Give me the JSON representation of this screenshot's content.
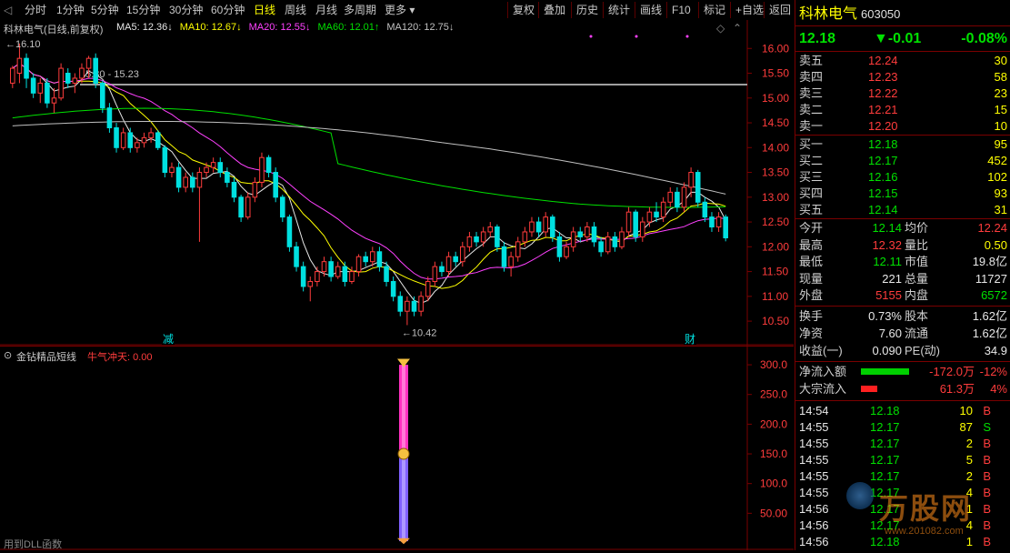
{
  "toolbar": {
    "periods": [
      "分时",
      "1分钟",
      "5分钟",
      "15分钟",
      "30分钟",
      "60分钟",
      "日线",
      "周线",
      "月线",
      "多周期",
      "更多"
    ],
    "active_period": "日线",
    "actions": [
      "复权",
      "叠加",
      "历史",
      "统计",
      "画线",
      "F10",
      "标记",
      "+自选",
      "返回"
    ]
  },
  "main_chart": {
    "title": "科林电气(日线,前复权)",
    "ma_legend": [
      {
        "label": "MA5: 12.36↓",
        "color": "#e8e8e8"
      },
      {
        "label": "MA10: 12.67↓",
        "color": "#ffff00"
      },
      {
        "label": "MA20: 12.55↓",
        "color": "#ff40ff"
      },
      {
        "label": "MA60: 12.01↑",
        "color": "#00e000"
      },
      {
        "label": "MA120: 12.75↓",
        "color": "#c0c0c0"
      }
    ],
    "high_label": "16.10",
    "low_label": "←10.42",
    "range_label": "15.30 - 15.23",
    "event_labels": [
      "减",
      "财"
    ],
    "y_ticks": [
      "16.00",
      "15.50",
      "15.00",
      "14.50",
      "14.00",
      "13.50",
      "13.00",
      "12.50",
      "12.00",
      "11.50",
      "11.00",
      "10.50"
    ]
  },
  "indicator": {
    "name": "金钻精品短线",
    "signal": "牛气冲天: 0.00",
    "y_ticks": [
      "300.0",
      "250.0",
      "200.0",
      "150.0",
      "100.0",
      "50.00"
    ],
    "bottom_text": "用到DLL函数"
  },
  "stock": {
    "name": "科林电气",
    "code": "603050",
    "price": "12.18",
    "change": "▼-0.01",
    "change_pct": "-0.08%"
  },
  "order_book": {
    "asks": [
      {
        "label": "卖五",
        "price": "12.24",
        "vol": "30"
      },
      {
        "label": "卖四",
        "price": "12.23",
        "vol": "58"
      },
      {
        "label": "卖三",
        "price": "12.22",
        "vol": "23"
      },
      {
        "label": "卖二",
        "price": "12.21",
        "vol": "15"
      },
      {
        "label": "卖一",
        "price": "12.20",
        "vol": "10"
      }
    ],
    "bids": [
      {
        "label": "买一",
        "price": "12.18",
        "vol": "95"
      },
      {
        "label": "买二",
        "price": "12.17",
        "vol": "452"
      },
      {
        "label": "买三",
        "price": "12.16",
        "vol": "102"
      },
      {
        "label": "买四",
        "price": "12.15",
        "vol": "93"
      },
      {
        "label": "买五",
        "price": "12.14",
        "vol": "31"
      }
    ]
  },
  "stats": [
    {
      "l1": "今开",
      "v1": "12.14",
      "c1": "grn",
      "l2": "均价",
      "v2": "12.24",
      "c2": "red"
    },
    {
      "l1": "最高",
      "v1": "12.32",
      "c1": "red",
      "l2": "量比",
      "v2": "0.50",
      "c2": "yel"
    },
    {
      "l1": "最低",
      "v1": "12.11",
      "c1": "grn",
      "l2": "市值",
      "v2": "19.8亿",
      "c2": "wht"
    },
    {
      "l1": "现量",
      "v1": "221",
      "c1": "wht",
      "l2": "总量",
      "v2": "11727",
      "c2": "wht"
    },
    {
      "l1": "外盘",
      "v1": "5155",
      "c1": "red",
      "l2": "内盘",
      "v2": "6572",
      "c2": "grn"
    }
  ],
  "stats2": [
    {
      "l1": "换手",
      "v1": "0.73%",
      "l2": "股本",
      "v2": "1.62亿"
    },
    {
      "l1": "净资",
      "v1": "7.60",
      "l2": "流通",
      "v2": "1.62亿"
    },
    {
      "l1": "收益(一)",
      "v1": "0.090",
      "l2": "PE(动)",
      "v2": "34.9"
    }
  ],
  "flows": [
    {
      "label": "净流入额",
      "value": "-172.0万",
      "pct": "-12%",
      "bar": "#00d000",
      "bar_fraction": 1.0
    },
    {
      "label": "大宗流入",
      "value": "61.3万",
      "pct": "4%",
      "bar": "#ff2020",
      "bar_fraction": 0.34
    }
  ],
  "ticks": [
    {
      "time": "14:54",
      "price": "12.18",
      "vol": "10",
      "bs": "B"
    },
    {
      "time": "14:55",
      "price": "12.17",
      "vol": "87",
      "bs": "S"
    },
    {
      "time": "14:55",
      "price": "12.17",
      "vol": "2",
      "bs": "B"
    },
    {
      "time": "14:55",
      "price": "12.17",
      "vol": "5",
      "bs": "B"
    },
    {
      "time": "14:55",
      "price": "12.17",
      "vol": "2",
      "bs": "B"
    },
    {
      "time": "14:55",
      "price": "12.17",
      "vol": "4",
      "bs": "B"
    },
    {
      "time": "14:56",
      "price": "12.17",
      "vol": "1",
      "bs": "B"
    },
    {
      "time": "14:56",
      "price": "12.17",
      "vol": "4",
      "bs": "B"
    },
    {
      "time": "14:56",
      "price": "12.18",
      "vol": "1",
      "bs": "B"
    }
  ],
  "watermark": {
    "text": "万股网",
    "url": "www.201082.com"
  },
  "colors": {
    "up": "#ff3c3c",
    "down": "#00e0e0",
    "ma5": "#e8e8e8",
    "ma10": "#ffff00",
    "ma20": "#ff40ff",
    "ma60": "#00e000",
    "ma120": "#c0c0c0",
    "frame": "#7a0000"
  },
  "candles": [
    [
      15.3,
      15.6,
      15.2,
      15.65
    ],
    [
      15.5,
      15.8,
      15.3,
      16.1
    ],
    [
      15.8,
      15.4,
      15.2,
      15.9
    ],
    [
      15.4,
      15.1,
      15.0,
      15.5
    ],
    [
      15.1,
      15.3,
      14.9,
      15.4
    ],
    [
      15.3,
      14.9,
      14.8,
      15.4
    ],
    [
      14.9,
      15.0,
      14.7,
      15.2
    ],
    [
      15.0,
      15.6,
      14.95,
      15.7
    ],
    [
      15.5,
      15.3,
      15.2,
      15.6
    ],
    [
      15.3,
      15.4,
      15.1,
      15.5
    ],
    [
      15.4,
      15.6,
      15.3,
      15.7
    ],
    [
      15.6,
      15.8,
      15.4,
      15.85
    ],
    [
      15.8,
      15.3,
      15.2,
      15.9
    ],
    [
      15.3,
      14.8,
      14.7,
      15.35
    ],
    [
      14.8,
      14.4,
      14.3,
      14.9
    ],
    [
      14.4,
      14.0,
      13.9,
      14.5
    ],
    [
      14.0,
      14.3,
      13.95,
      14.4
    ],
    [
      14.3,
      14.0,
      13.9,
      14.4
    ],
    [
      14.0,
      14.1,
      13.9,
      14.2
    ],
    [
      14.1,
      14.2,
      14.0,
      14.3
    ],
    [
      14.2,
      14.3,
      14.1,
      14.4
    ],
    [
      14.3,
      14.0,
      13.95,
      14.35
    ],
    [
      14.0,
      13.5,
      13.4,
      14.05
    ],
    [
      13.5,
      13.6,
      13.4,
      13.7
    ],
    [
      13.6,
      13.2,
      13.1,
      13.7
    ],
    [
      13.2,
      13.4,
      13.1,
      13.5
    ],
    [
      13.4,
      13.2,
      13.1,
      13.5
    ],
    [
      13.2,
      13.5,
      12.1,
      13.6
    ],
    [
      13.5,
      13.6,
      13.4,
      13.7
    ],
    [
      13.6,
      13.7,
      13.5,
      13.8
    ],
    [
      13.7,
      13.5,
      13.4,
      13.8
    ],
    [
      13.5,
      13.3,
      13.2,
      13.6
    ],
    [
      13.3,
      13.0,
      12.9,
      13.4
    ],
    [
      13.0,
      12.6,
      12.5,
      13.05
    ],
    [
      12.6,
      13.0,
      12.55,
      13.1
    ],
    [
      13.0,
      13.3,
      12.9,
      13.4
    ],
    [
      13.3,
      13.8,
      13.2,
      13.9
    ],
    [
      13.8,
      13.5,
      13.4,
      13.85
    ],
    [
      13.5,
      13.0,
      12.9,
      13.6
    ],
    [
      13.0,
      12.6,
      12.5,
      13.05
    ],
    [
      12.6,
      12.0,
      11.9,
      12.65
    ],
    [
      12.0,
      11.6,
      11.5,
      12.1
    ],
    [
      11.6,
      11.2,
      11.1,
      11.7
    ],
    [
      11.2,
      11.3,
      10.9,
      11.4
    ],
    [
      11.3,
      11.5,
      11.2,
      11.6
    ],
    [
      11.5,
      11.7,
      11.4,
      11.8
    ],
    [
      11.7,
      11.4,
      11.3,
      11.8
    ],
    [
      11.4,
      11.6,
      11.35,
      11.7
    ],
    [
      11.6,
      11.3,
      11.2,
      11.7
    ],
    [
      11.3,
      11.5,
      11.25,
      11.6
    ],
    [
      11.5,
      11.8,
      11.4,
      11.85
    ],
    [
      11.8,
      11.7,
      11.6,
      11.9
    ],
    [
      11.7,
      11.9,
      11.6,
      12.0
    ],
    [
      11.9,
      11.6,
      11.5,
      12.0
    ],
    [
      11.6,
      11.3,
      11.2,
      11.7
    ],
    [
      11.3,
      11.0,
      10.9,
      11.4
    ],
    [
      11.0,
      10.7,
      10.6,
      11.1
    ],
    [
      10.7,
      10.9,
      10.42,
      11.0
    ],
    [
      10.9,
      10.7,
      10.6,
      11.0
    ],
    [
      10.7,
      11.0,
      10.6,
      11.1
    ],
    [
      11.0,
      11.3,
      10.9,
      11.4
    ],
    [
      11.3,
      11.6,
      11.2,
      11.7
    ],
    [
      11.6,
      11.5,
      11.4,
      11.7
    ],
    [
      11.5,
      11.8,
      11.4,
      11.9
    ],
    [
      11.8,
      11.7,
      11.6,
      11.9
    ],
    [
      11.7,
      12.0,
      11.6,
      12.1
    ],
    [
      12.0,
      12.2,
      11.9,
      12.3
    ],
    [
      12.2,
      12.1,
      12.0,
      12.3
    ],
    [
      12.1,
      12.3,
      12.0,
      12.4
    ],
    [
      12.3,
      12.4,
      12.2,
      12.5
    ],
    [
      12.4,
      12.0,
      11.9,
      12.45
    ],
    [
      12.0,
      11.6,
      11.5,
      12.1
    ],
    [
      11.6,
      11.8,
      11.4,
      11.9
    ],
    [
      11.8,
      12.1,
      11.7,
      12.2
    ],
    [
      12.1,
      12.3,
      12.0,
      12.4
    ],
    [
      12.3,
      12.5,
      12.2,
      12.6
    ],
    [
      12.5,
      12.3,
      12.2,
      12.6
    ],
    [
      12.3,
      12.6,
      12.2,
      12.7
    ],
    [
      12.6,
      12.2,
      12.1,
      12.65
    ],
    [
      12.2,
      11.8,
      11.7,
      12.3
    ],
    [
      11.8,
      12.0,
      11.75,
      12.1
    ],
    [
      12.0,
      12.3,
      11.9,
      12.4
    ],
    [
      12.3,
      12.2,
      12.1,
      12.4
    ],
    [
      12.2,
      12.4,
      12.1,
      12.5
    ],
    [
      12.4,
      12.1,
      12.0,
      12.5
    ],
    [
      12.1,
      11.9,
      11.8,
      12.2
    ],
    [
      11.9,
      12.2,
      11.85,
      12.3
    ],
    [
      12.2,
      12.0,
      11.9,
      12.3
    ],
    [
      12.0,
      12.3,
      11.95,
      12.4
    ],
    [
      12.3,
      12.7,
      12.2,
      12.8
    ],
    [
      12.7,
      12.2,
      12.1,
      12.75
    ],
    [
      12.2,
      12.5,
      12.1,
      12.6
    ],
    [
      12.5,
      12.7,
      12.4,
      12.8
    ],
    [
      12.7,
      12.6,
      12.5,
      12.9
    ],
    [
      12.6,
      12.9,
      12.5,
      13.0
    ],
    [
      12.9,
      13.1,
      12.8,
      13.2
    ],
    [
      13.1,
      12.8,
      12.7,
      13.2
    ],
    [
      12.8,
      13.2,
      12.7,
      13.3
    ],
    [
      13.2,
      13.5,
      13.0,
      13.6
    ],
    [
      13.5,
      12.9,
      12.8,
      13.55
    ],
    [
      12.9,
      12.6,
      12.5,
      13.0
    ],
    [
      12.6,
      12.4,
      12.3,
      12.7
    ],
    [
      12.4,
      12.6,
      12.3,
      12.7
    ],
    [
      12.6,
      12.18,
      12.11,
      12.65
    ]
  ]
}
